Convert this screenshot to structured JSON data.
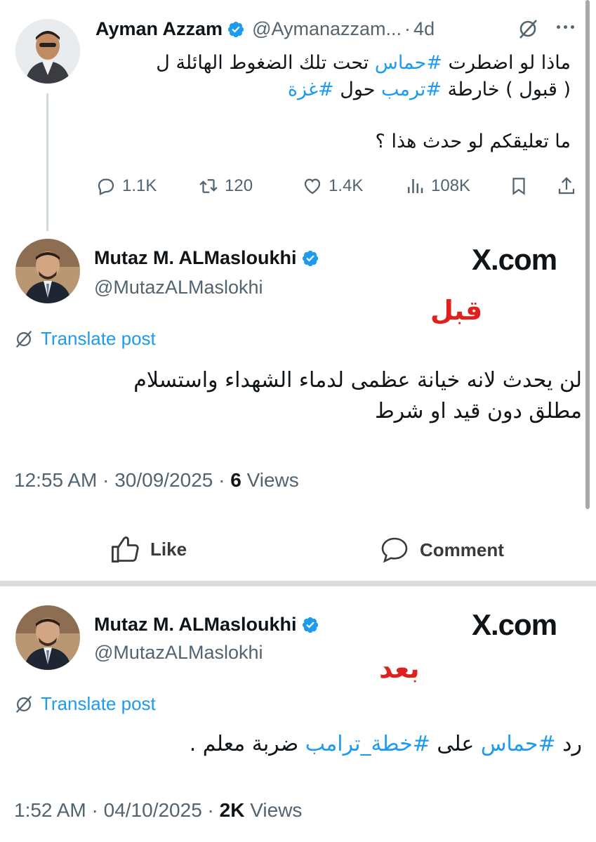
{
  "quoted_post": {
    "author_name": "Ayman Azzam",
    "author_handle": "@Aymanazzam...",
    "time_ago": "4d",
    "text_line1_pre": "ماذا لو اضطرت ",
    "text_line1_tag": "#حماس",
    "text_line1_post": " تحت تلك الضغوط الهائلة ل",
    "text_line2_pre": "( قبول ) خارطة ",
    "text_line2_tag1": "#ترمب",
    "text_line2_mid": " حول ",
    "text_line2_tag2": "#غزة",
    "text_line3": "ما تعليقكم لو حدث هذا ؟",
    "metrics": {
      "replies": "1.1K",
      "reposts": "120",
      "likes": "1.4K",
      "views": "108K"
    }
  },
  "before_post": {
    "author_name": "Mutaz M. ALMasloukhi",
    "author_handle": "@MutazALMaslokhi",
    "site_label": "X.com",
    "overlay_label": "قبل",
    "translate_label": "Translate post",
    "text_line1": "لن يحدث لانه خيانة عظمى لدماء الشهداء واستسلام",
    "text_line2": "مطلق دون قيد او شرط",
    "time": "12:55 AM",
    "date": "30/09/2025",
    "views_count": "6",
    "views_label": "Views"
  },
  "actions": {
    "like_label": "Like",
    "comment_label": "Comment"
  },
  "after_post": {
    "author_name": "Mutaz M. ALMasloukhi",
    "author_handle": "@MutazALMaslokhi",
    "site_label": "X.com",
    "overlay_label": "بعد",
    "translate_label": "Translate post",
    "text_pre": "رد ",
    "text_tag1": "#حماس",
    "text_mid": " على ",
    "text_tag2": "#خطة_ترامب",
    "text_post": " ضربة معلم .",
    "time": "1:52 AM",
    "date": "04/10/2025",
    "views_count": "2K",
    "views_label": "Views"
  },
  "colors": {
    "accent": "#1d9bf0",
    "text": "#0f1419",
    "muted": "#536471",
    "overlay_red": "#e0201c"
  },
  "icons": [
    "verified-badge-icon",
    "grok-icon",
    "more-icon",
    "reply-icon",
    "repost-icon",
    "like-heart-icon",
    "views-icon",
    "bookmark-icon",
    "share-icon",
    "translate-globe-icon",
    "thumbs-up-icon",
    "comment-bubble-icon"
  ]
}
